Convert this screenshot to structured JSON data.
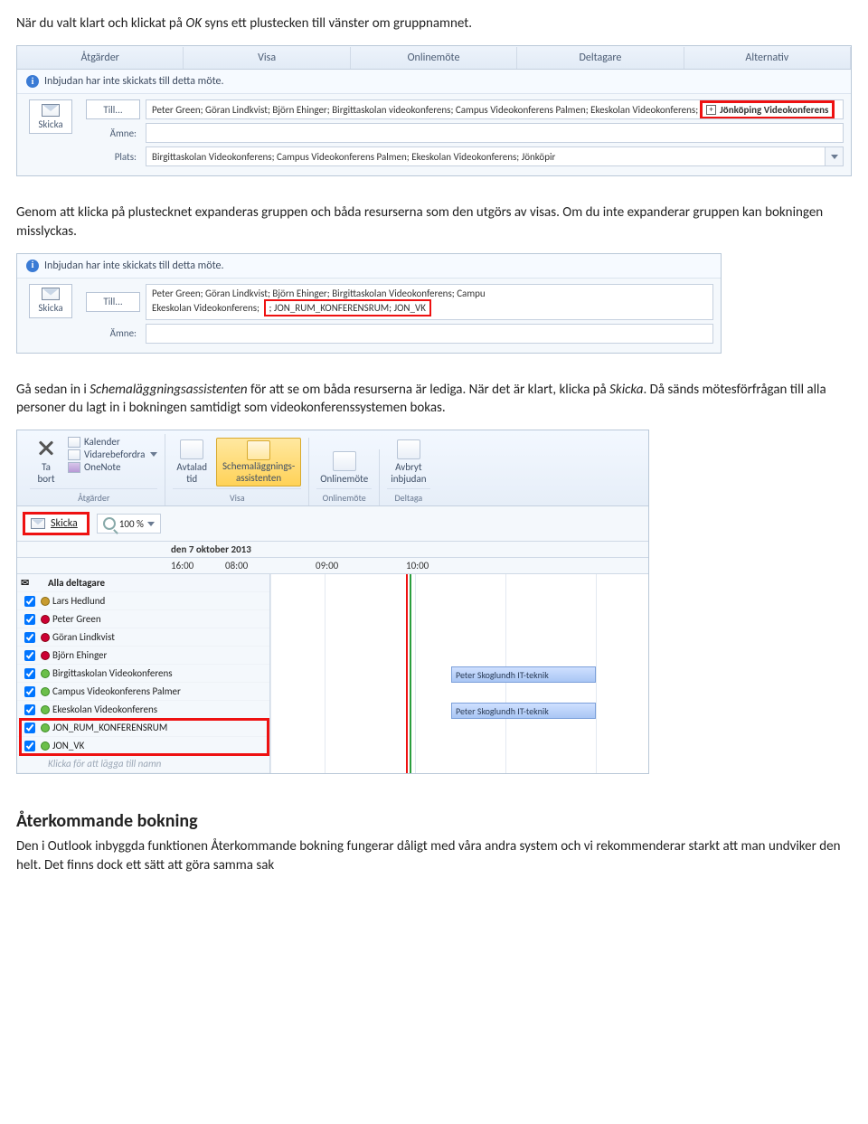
{
  "para1_a": "När du valt klart och klickat på ",
  "para1_ok": "OK",
  "para1_b": " syns ett plustecken till vänster om gruppnamnet.",
  "para2": "Genom att klicka på plustecknet expanderas gruppen och båda resurserna som den utgörs av visas. Om du inte expanderar gruppen kan bokningen misslyckas.",
  "para3_a": "Gå sedan in i ",
  "para3_i1": "Schemaläggningsassistenten",
  "para3_b": " för att se om båda resurserna är lediga. När det är klart, klicka på ",
  "para3_i2": "Skicka",
  "para3_c": ". Då sänds mötesförfrågan till alla personer du lagt in i bokningen samtidigt som videokonferenssystemen bokas.",
  "heading2": "Återkommande bokning",
  "para4": "Den i Outlook inbyggda funktionen Återkommande bokning fungerar dåligt med våra andra system och vi rekommenderar starkt att man undviker den helt. Det finns dock ett sätt att göra samma sak",
  "ribbon_tabs": {
    "a": "Åtgärder",
    "b": "Visa",
    "c": "Onlinemöte",
    "d": "Deltagare",
    "e": "Alternativ"
  },
  "shot1": {
    "info": "Inbjudan har inte skickats till detta möte.",
    "skicka": "Skicka",
    "till": "Till...",
    "amne": "Ämne:",
    "plats": "Plats:",
    "to_line_a": "Peter Green; Göran Lindkvist; Björn Ehinger; Birgittaskolan videokonferens; Campus Videokonferens Palmen; Ekeskolan Videokonferens;",
    "to_line_group": "Jönköping Videokonferens",
    "plats_val": "Birgittaskolan Videokonferens; Campus Videokonferens Palmen; Ekeskolan Videokonferens; Jönköpir"
  },
  "shot2": {
    "info": "Inbjudan har inte skickats till detta möte.",
    "skicka": "Skicka",
    "till": "Till...",
    "amne": "Ämne:",
    "to_line_a": "Peter Green; Göran Lindkvist; Björn Ehinger; Birgittaskolan Videokonferens; Campu",
    "to_line_b_prefix": "Ekeskolan Videokonferens;",
    "to_line_b_hl": "; JON_RUM_KONFERENSRUM; JON_VK"
  },
  "shot3": {
    "ta_bort": "Ta\nbort",
    "kalender": "Kalender",
    "vidare": "Vidarebefordra",
    "onenote": "OneNote",
    "atgarder": "Åtgärder",
    "avtalad": "Avtalad\ntid",
    "sched": "Schemaläggnings-\nassistenten",
    "visa": "Visa",
    "online": "Onlinemöte",
    "online_grp": "Onlinemöte",
    "avbryt": "Avbryt\ninbjudan",
    "deltaga": "Deltaga",
    "skicka": "Skicka",
    "zoom": "100 %",
    "date": "den 7 oktober 2013",
    "h1": "16:00",
    "h2": "08:00",
    "h3": "09:00",
    "h4": "10:00",
    "hdr": "Alla deltagare",
    "p1": "Lars Hedlund",
    "p2": "Peter Green",
    "p3": "Göran Lindkvist",
    "p4": "Björn Ehinger",
    "p5": "Birgittaskolan Videokonferens",
    "p6": "Campus Videokonferens Palmer",
    "p7": "Ekeskolan Videokonferens",
    "p8": "JON_RUM_KONFERENSRUM",
    "p9": "JON_VK",
    "add": "Klicka för att lägga till namn",
    "busy": "Peter Skoglundh IT-teknik"
  }
}
